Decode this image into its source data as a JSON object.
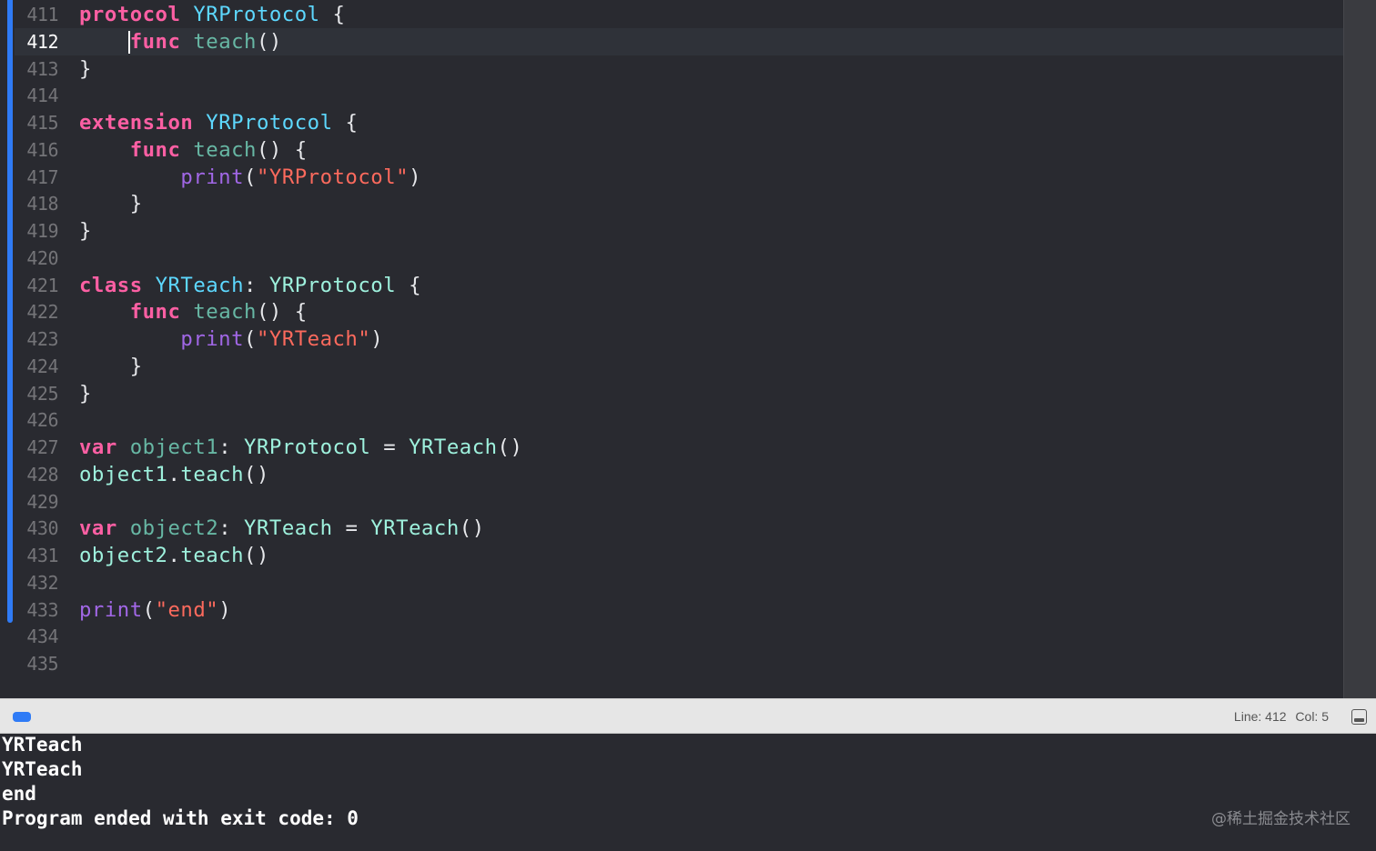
{
  "editor": {
    "current_line": "412",
    "lines": [
      {
        "num": "411",
        "tokens": [
          [
            "kw",
            "protocol"
          ],
          [
            "plain",
            " "
          ],
          [
            "type-decl",
            "YRProtocol"
          ],
          [
            "plain",
            " {"
          ]
        ]
      },
      {
        "num": "412",
        "tokens": [
          [
            "plain",
            "    "
          ],
          [
            "kw",
            "func"
          ],
          [
            "plain",
            " "
          ],
          [
            "func-decl",
            "teach"
          ],
          [
            "plain",
            "()"
          ]
        ]
      },
      {
        "num": "413",
        "tokens": [
          [
            "plain",
            "}"
          ]
        ]
      },
      {
        "num": "414",
        "tokens": []
      },
      {
        "num": "415",
        "tokens": [
          [
            "kw",
            "extension"
          ],
          [
            "plain",
            " "
          ],
          [
            "type-decl",
            "YRProtocol"
          ],
          [
            "plain",
            " {"
          ]
        ]
      },
      {
        "num": "416",
        "tokens": [
          [
            "plain",
            "    "
          ],
          [
            "kw",
            "func"
          ],
          [
            "plain",
            " "
          ],
          [
            "func-decl",
            "teach"
          ],
          [
            "plain",
            "() {"
          ]
        ]
      },
      {
        "num": "417",
        "tokens": [
          [
            "plain",
            "        "
          ],
          [
            "builtin",
            "print"
          ],
          [
            "plain",
            "("
          ],
          [
            "str",
            "\"YRProtocol\""
          ],
          [
            "plain",
            ")"
          ]
        ]
      },
      {
        "num": "418",
        "tokens": [
          [
            "plain",
            "    }"
          ]
        ]
      },
      {
        "num": "419",
        "tokens": [
          [
            "plain",
            "}"
          ]
        ]
      },
      {
        "num": "420",
        "tokens": []
      },
      {
        "num": "421",
        "tokens": [
          [
            "kw",
            "class"
          ],
          [
            "plain",
            " "
          ],
          [
            "type-decl",
            "YRTeach"
          ],
          [
            "plain",
            ": "
          ],
          [
            "type-ref",
            "YRProtocol"
          ],
          [
            "plain",
            " {"
          ]
        ]
      },
      {
        "num": "422",
        "tokens": [
          [
            "plain",
            "    "
          ],
          [
            "kw",
            "func"
          ],
          [
            "plain",
            " "
          ],
          [
            "func-decl",
            "teach"
          ],
          [
            "plain",
            "() {"
          ]
        ]
      },
      {
        "num": "423",
        "tokens": [
          [
            "plain",
            "        "
          ],
          [
            "builtin",
            "print"
          ],
          [
            "plain",
            "("
          ],
          [
            "str",
            "\"YRTeach\""
          ],
          [
            "plain",
            ")"
          ]
        ]
      },
      {
        "num": "424",
        "tokens": [
          [
            "plain",
            "    }"
          ]
        ]
      },
      {
        "num": "425",
        "tokens": [
          [
            "plain",
            "}"
          ]
        ]
      },
      {
        "num": "426",
        "tokens": []
      },
      {
        "num": "427",
        "tokens": [
          [
            "kw",
            "var"
          ],
          [
            "plain",
            " "
          ],
          [
            "var-decl",
            "object1"
          ],
          [
            "plain",
            ": "
          ],
          [
            "type-ref",
            "YRProtocol"
          ],
          [
            "plain",
            " = "
          ],
          [
            "type-ref",
            "YRTeach"
          ],
          [
            "plain",
            "()"
          ]
        ]
      },
      {
        "num": "428",
        "tokens": [
          [
            "var-ref",
            "object1"
          ],
          [
            "plain",
            "."
          ],
          [
            "method-ref",
            "teach"
          ],
          [
            "plain",
            "()"
          ]
        ]
      },
      {
        "num": "429",
        "tokens": []
      },
      {
        "num": "430",
        "tokens": [
          [
            "kw",
            "var"
          ],
          [
            "plain",
            " "
          ],
          [
            "var-decl",
            "object2"
          ],
          [
            "plain",
            ": "
          ],
          [
            "type-ref",
            "YRTeach"
          ],
          [
            "plain",
            " = "
          ],
          [
            "type-ref",
            "YRTeach"
          ],
          [
            "plain",
            "()"
          ]
        ]
      },
      {
        "num": "431",
        "tokens": [
          [
            "var-ref",
            "object2"
          ],
          [
            "plain",
            "."
          ],
          [
            "method-ref",
            "teach"
          ],
          [
            "plain",
            "()"
          ]
        ]
      },
      {
        "num": "432",
        "tokens": []
      },
      {
        "num": "433",
        "tokens": [
          [
            "builtin",
            "print"
          ],
          [
            "plain",
            "("
          ],
          [
            "str",
            "\"end\""
          ],
          [
            "plain",
            ")"
          ]
        ]
      },
      {
        "num": "434",
        "tokens": []
      },
      {
        "num": "435",
        "tokens": []
      }
    ]
  },
  "status_bar": {
    "debug_toggle_icon": "debug-area-toggle-icon",
    "line_label": "Line: 412",
    "col_label": "Col: 5",
    "panel_toggle_icon": "hide-debug-area-icon"
  },
  "console": {
    "lines": [
      "YRTeach",
      "YRTeach",
      "end",
      "Program ended with exit code: 0"
    ]
  },
  "watermark": "@稀土掘金技术社区",
  "colors": {
    "background": "#292a30",
    "keyword": "#fc5fa3",
    "type_declaration": "#5dd8ff",
    "function_declaration": "#67b7a4",
    "builtin_function": "#a167e6",
    "string": "#fc6a5d",
    "type_reference": "#9ef1dd",
    "change_bar": "#2f7bf6"
  }
}
